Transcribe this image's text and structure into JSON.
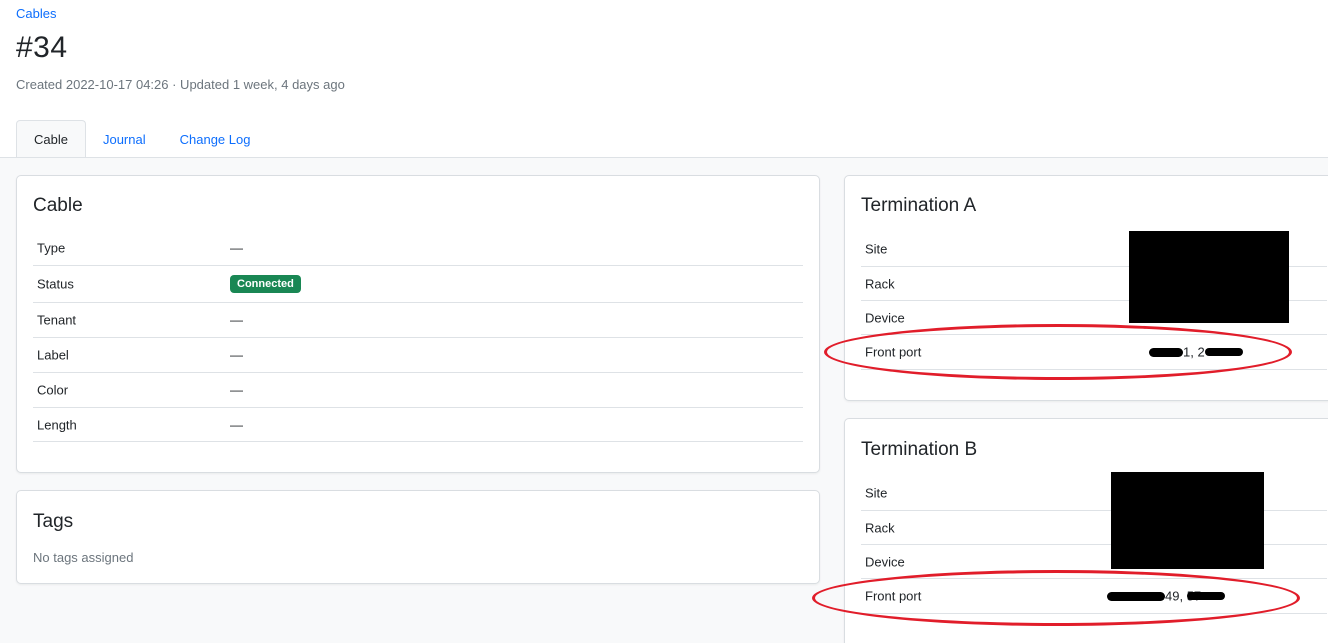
{
  "breadcrumb": "Cables",
  "title": "#34",
  "meta": "Created 2022-10-17 04:26 · Updated 1 week, 4 days ago",
  "tabs": [
    "Cable",
    "Journal",
    "Change Log"
  ],
  "cable_card": {
    "title": "Cable",
    "rows": [
      {
        "key": "Type",
        "value": "—"
      },
      {
        "key": "Status",
        "value": "Connected"
      },
      {
        "key": "Tenant",
        "value": "—"
      },
      {
        "key": "Label",
        "value": "—"
      },
      {
        "key": "Color",
        "value": "—"
      },
      {
        "key": "Length",
        "value": "—"
      }
    ]
  },
  "tags_card": {
    "title": "Tags",
    "empty_text": "No tags assigned"
  },
  "termination_a": {
    "title": "Termination A",
    "rows": [
      {
        "key": "Site"
      },
      {
        "key": "Rack"
      },
      {
        "key": "Device"
      },
      {
        "key": "Front port",
        "link_parts": [
          "1, ",
          "2"
        ]
      }
    ]
  },
  "termination_b": {
    "title": "Termination B",
    "rows": [
      {
        "key": "Site"
      },
      {
        "key": "Rack"
      },
      {
        "key": "Device"
      },
      {
        "key": "Front port",
        "link_parts": [
          "49, ",
          "57"
        ]
      }
    ]
  },
  "colors": {
    "accent": "#0d6efd",
    "success": "#198754",
    "annotation": "#e11d2a"
  }
}
